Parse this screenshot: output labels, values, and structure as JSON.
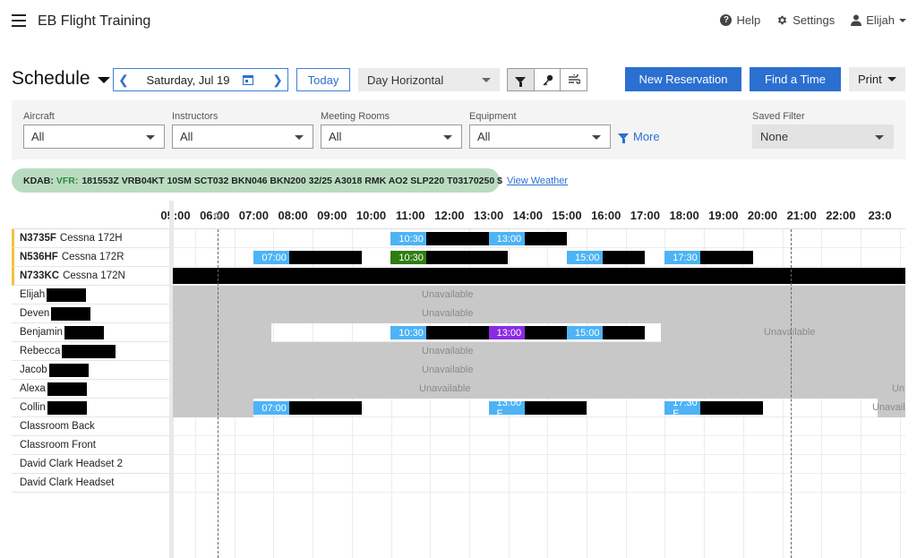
{
  "app": {
    "title": "EB Flight Training",
    "help": "Help",
    "settings": "Settings",
    "user": "Elijah"
  },
  "toolbar": {
    "schedule_title": "Schedule",
    "date": "Saturday, Jul 19",
    "today": "Today",
    "view": "Day Horizontal",
    "new_reservation": "New Reservation",
    "find_time": "Find a Time",
    "print": "Print"
  },
  "filters": {
    "aircraft": {
      "label": "Aircraft",
      "value": "All"
    },
    "instructors": {
      "label": "Instructors",
      "value": "All"
    },
    "meeting_rooms": {
      "label": "Meeting Rooms",
      "value": "All"
    },
    "equipment": {
      "label": "Equipment",
      "value": "All"
    },
    "more": "More",
    "saved_filter": {
      "label": "Saved Filter",
      "value": "None"
    }
  },
  "weather": {
    "station": "KDAB:",
    "category": "VFR:",
    "metar": "181553Z VRB04KT 10SM SCT032 BKN046 BKN200 32/25 A3018 RMK AO2 SLP220 T03170250 $",
    "link": "View Weather"
  },
  "hours": [
    "05:00",
    "06:00",
    "07:00",
    "08:00",
    "09:00",
    "10:00",
    "11:00",
    "12:00",
    "13:00",
    "14:00",
    "15:00",
    "16:00",
    "17:00",
    "18:00",
    "19:00",
    "20:00",
    "21:00",
    "22:00",
    "23:0"
  ],
  "resources": [
    {
      "tail": "N3735F",
      "name": "Cessna 172H",
      "type": "aircraft"
    },
    {
      "tail": "N536HF",
      "name": "Cessna 172R",
      "type": "aircraft"
    },
    {
      "tail": "N733KC",
      "name": "Cessna 172N",
      "type": "aircraft"
    },
    {
      "name": "Elijah",
      "type": "instructor"
    },
    {
      "name": "Deven",
      "type": "instructor"
    },
    {
      "name": "Benjamin",
      "type": "instructor"
    },
    {
      "name": "Rebecca",
      "type": "instructor"
    },
    {
      "name": "Jacob",
      "type": "instructor"
    },
    {
      "name": "Alexa",
      "type": "instructor"
    },
    {
      "name": "Collin",
      "type": "instructor"
    },
    {
      "name": "Classroom Back",
      "type": "room"
    },
    {
      "name": "Classroom Front",
      "type": "room"
    },
    {
      "name": "David Clark Headset 2",
      "type": "equipment"
    },
    {
      "name": "David Clark Headset",
      "type": "equipment"
    }
  ],
  "unavailable_label": "Unavailable",
  "unavailable_partial_label": "Unavailable",
  "unavailable_short_label": "Un",
  "unavailable_collin_label": "Unavail",
  "reservations": [
    {
      "row": 0,
      "start": "10:30",
      "end": "13:00",
      "label": "10:30",
      "color": "#4db3f5"
    },
    {
      "row": 0,
      "start": "13:00",
      "end": "15:00",
      "label": "13:00",
      "color": "#4db3f5"
    },
    {
      "row": 1,
      "start": "07:00",
      "end": "09:45",
      "label": "07:00",
      "color": "#4db3f5"
    },
    {
      "row": 1,
      "start": "10:30",
      "end": "13:30",
      "label": "10:30",
      "color": "#2e7d12"
    },
    {
      "row": 1,
      "start": "15:00",
      "end": "17:00",
      "label": "15:00",
      "color": "#4db3f5"
    },
    {
      "row": 1,
      "start": "17:30",
      "end": "19:45",
      "label": "17:30",
      "color": "#4db3f5"
    },
    {
      "row": 2,
      "start": "05:00",
      "end": "24:00",
      "label": "",
      "color": "#000000"
    },
    {
      "row": 5,
      "start": "10:30",
      "end": "13:00",
      "label": "10:30",
      "color": "#4db3f5"
    },
    {
      "row": 5,
      "start": "13:00",
      "end": "15:00",
      "label": "13:00",
      "color": "#8a2be2"
    },
    {
      "row": 5,
      "start": "15:00",
      "end": "17:00",
      "label": "15:00",
      "color": "#4db3f5"
    },
    {
      "row": 9,
      "start": "07:00",
      "end": "09:45",
      "label": "07:00",
      "color": "#4db3f5"
    },
    {
      "row": 9,
      "start": "13:00",
      "end": "15:30",
      "label": "13:00 F",
      "color": "#4db3f5"
    },
    {
      "row": 9,
      "start": "17:30",
      "end": "20:00",
      "label": "17:30 F",
      "color": "#4db3f5"
    }
  ]
}
